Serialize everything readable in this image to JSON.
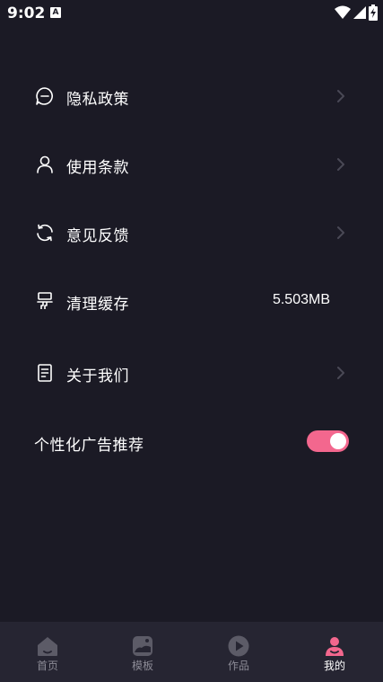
{
  "status_bar": {
    "time": "9:02",
    "notification_badge": "A"
  },
  "menu": {
    "items": [
      {
        "label": "隐私政策",
        "icon": "privacy-chat-icon",
        "has_chevron": true
      },
      {
        "label": "使用条款",
        "icon": "user-icon",
        "has_chevron": true
      },
      {
        "label": "意见反馈",
        "icon": "refresh-feedback-icon",
        "has_chevron": true
      },
      {
        "label": "清理缓存",
        "icon": "brush-icon",
        "value": "5.503MB"
      },
      {
        "label": "关于我们",
        "icon": "document-icon",
        "has_chevron": true
      }
    ],
    "ad_toggle": {
      "label": "个性化广告推荐",
      "enabled": true
    }
  },
  "tab_bar": {
    "tabs": [
      {
        "label": "首页",
        "icon": "home-icon",
        "active": false
      },
      {
        "label": "模板",
        "icon": "template-icon",
        "active": false
      },
      {
        "label": "作品",
        "icon": "play-icon",
        "active": false
      },
      {
        "label": "我的",
        "icon": "profile-icon",
        "active": true
      }
    ]
  },
  "colors": {
    "background": "#1b1a25",
    "tab_bar": "#262532",
    "accent": "#f3678e",
    "inactive": "#8c8b96"
  }
}
